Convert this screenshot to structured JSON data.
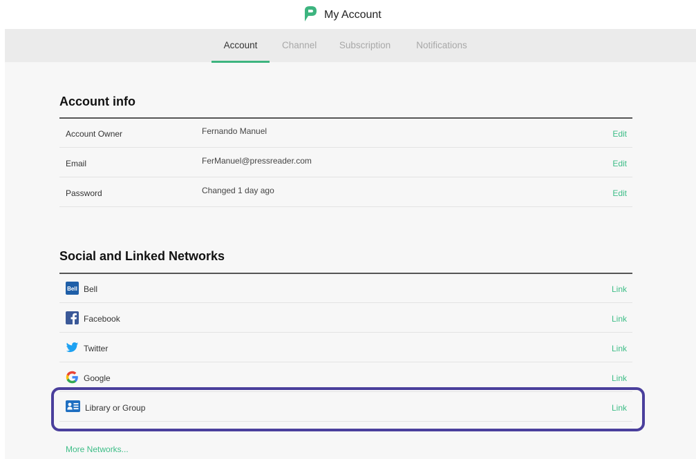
{
  "header": {
    "title": "My Account",
    "logo_icon": "pressreader-logo-icon",
    "brand_color": "#3db47f"
  },
  "tabs": [
    {
      "label": "Account",
      "active": true
    },
    {
      "label": "Channel",
      "active": false
    },
    {
      "label": "Subscription",
      "active": false
    },
    {
      "label": "Notifications",
      "active": false
    }
  ],
  "account_info": {
    "title": "Account info",
    "rows": [
      {
        "label": "Account Owner",
        "value": "Fernando Manuel",
        "action": "Edit"
      },
      {
        "label": "Email",
        "value": "FerManuel@pressreader.com",
        "action": "Edit"
      },
      {
        "label": "Password",
        "value": "Changed 1 day ago",
        "action": "Edit"
      }
    ]
  },
  "networks": {
    "title": "Social and Linked Networks",
    "items": [
      {
        "label": "Bell",
        "icon": "bell-icon",
        "action": "Link"
      },
      {
        "label": "Facebook",
        "icon": "facebook-icon",
        "action": "Link"
      },
      {
        "label": "Twitter",
        "icon": "twitter-icon",
        "action": "Link"
      },
      {
        "label": "Google",
        "icon": "google-icon",
        "action": "Link"
      },
      {
        "label": "Library or Group",
        "icon": "library-card-icon",
        "action": "Link"
      }
    ],
    "more_label": "More Networks..."
  },
  "colors": {
    "accent": "#3db47f",
    "highlight": "#4a3f9c"
  }
}
